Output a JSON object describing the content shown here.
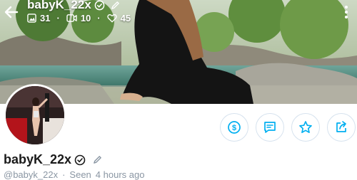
{
  "header": {
    "title": "babyK_22x",
    "stats": {
      "photos": "31",
      "videos": "10",
      "likes": "45"
    }
  },
  "profile": {
    "name": "babyK_22x",
    "handle": "@babyk_22x",
    "separator": "·",
    "seen": "Seen",
    "last_seen": "4 hours ago"
  },
  "actions": [
    {
      "name": "tip",
      "icon": "dollar-icon"
    },
    {
      "name": "message",
      "icon": "message-icon"
    },
    {
      "name": "favorite",
      "icon": "star-icon"
    },
    {
      "name": "share",
      "icon": "share-icon"
    }
  ],
  "colors": {
    "accent": "#00aff0",
    "muted": "#8a96a3",
    "border": "#d6e2ee"
  }
}
